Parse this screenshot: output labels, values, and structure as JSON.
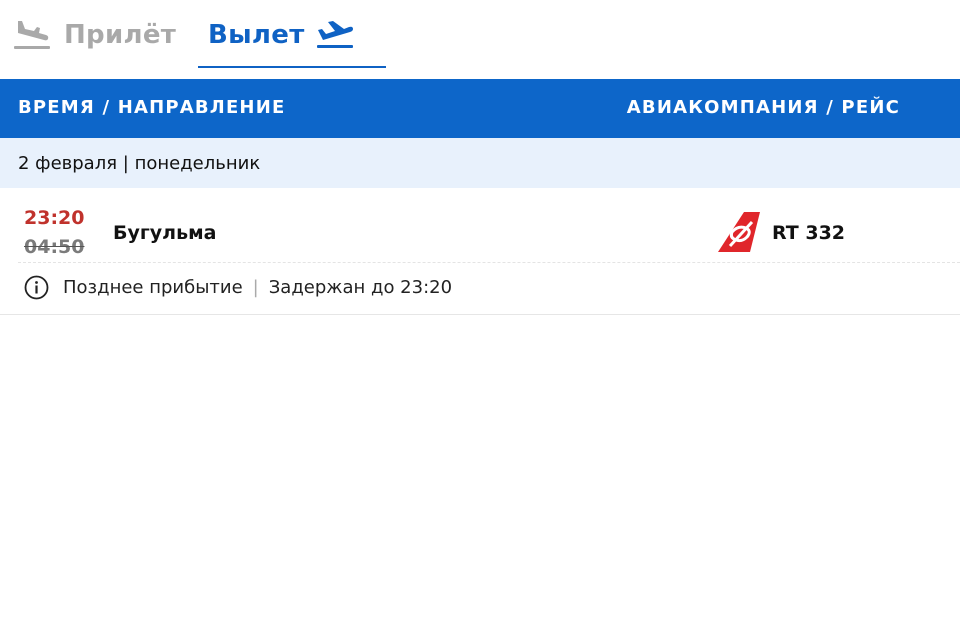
{
  "tabs": {
    "arrival": {
      "label": "Прилёт",
      "icon": "plane-landing-icon"
    },
    "departure": {
      "label": "Вылет",
      "icon": "plane-takeoff-icon",
      "active": true
    }
  },
  "table_header": {
    "left": "ВРЕМЯ / НАПРАВЛЕНИЕ",
    "right": "АВИАКОМПАНИЯ / РЕЙС"
  },
  "date_group": {
    "date": "2 февраля",
    "separator": "|",
    "weekday": "понедельник"
  },
  "flights": [
    {
      "time_actual": "23:20",
      "time_scheduled": "04:50",
      "destination": "Бугульма",
      "airline_logo": "airline-logo-icon",
      "flight_number": "RT 332",
      "status_note": "Позднее прибытие",
      "status_separator": "|",
      "status": "Задержан до 23:20"
    }
  ],
  "colors": {
    "accent": "#0f62c4",
    "header_bg": "#0d66c9",
    "date_row_bg": "#e8f1fc",
    "delay_red": "#c0322c",
    "inactive_gray": "#a9a9a9",
    "logo_red": "#e0262b"
  }
}
